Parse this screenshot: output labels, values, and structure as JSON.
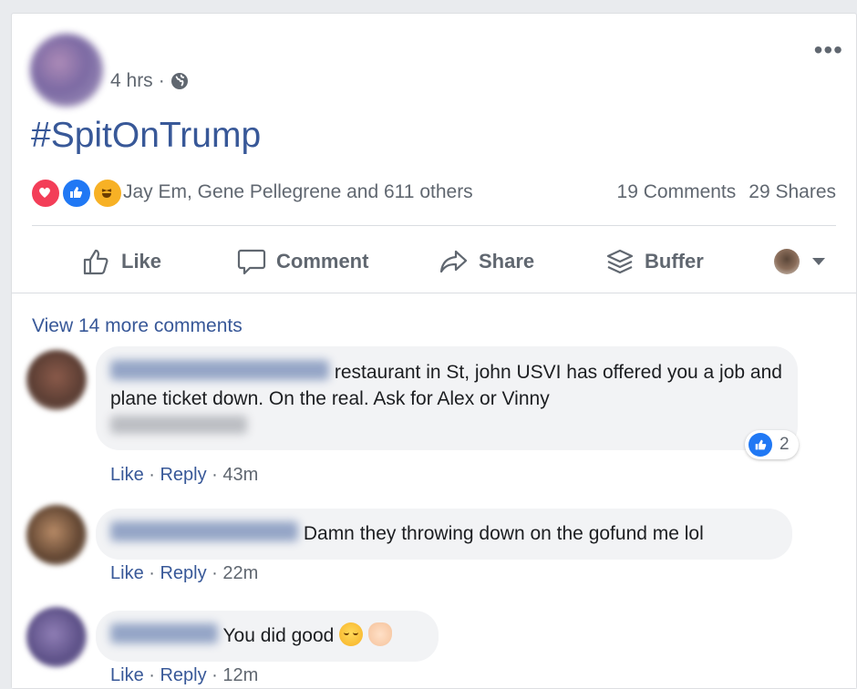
{
  "post": {
    "time": "4 hrs",
    "dot": "·",
    "hashtag": "#SpitOnTrump",
    "reactions_text": "Jay Em, Gene Pellegrene and 611 others",
    "comments_count": "19 Comments",
    "shares_count": "29 Shares",
    "more": "•••"
  },
  "actions": {
    "like": "Like",
    "comment": "Comment",
    "share": "Share",
    "buffer": "Buffer"
  },
  "comments_section": {
    "view_more": "View 14 more comments",
    "items": [
      {
        "text": "restaurant in St, john USVI has offered you a job and plane ticket down. On the real. Ask for Alex or Vinny",
        "like": "Like",
        "reply": "Reply",
        "time": "43m",
        "reaction_count": "2"
      },
      {
        "text": "Damn they throwing down on the gofund me lol",
        "like": "Like",
        "reply": "Reply",
        "time": "22m"
      },
      {
        "text": "You did good",
        "like": "Like",
        "reply": "Reply",
        "time": "12m"
      }
    ]
  },
  "colors": {
    "link": "#385898",
    "secondary_text": "#606770",
    "bubble": "#f2f3f5",
    "love": "#f33e58",
    "like": "#2078f4",
    "haha": "#f7b125"
  },
  "icons": [
    "globe-icon",
    "more-icon",
    "love-reaction-icon",
    "like-reaction-icon",
    "haha-reaction-icon",
    "thumbs-up-icon",
    "comment-icon",
    "share-icon",
    "buffer-icon",
    "chevron-down-icon",
    "relieved-emoji-icon",
    "clapping-hands-icon"
  ]
}
